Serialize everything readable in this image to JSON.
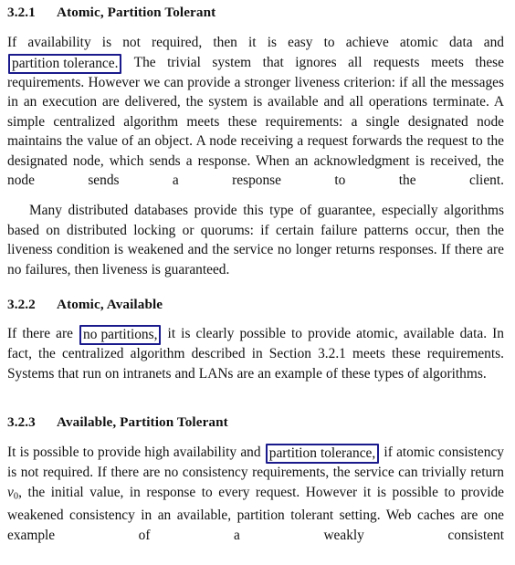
{
  "document": {
    "type": "scanned-paper-excerpt",
    "background_color": "#ffffff",
    "text_color": "#111111",
    "annotation_box_color": "#1a1a8c"
  },
  "sections": [
    {
      "number": "3.2.1",
      "title": "Atomic, Partition Tolerant",
      "paragraphs": [
        {
          "id": "p1",
          "indent": false,
          "runs": [
            {
              "type": "text",
              "text": "If availability is not required, then it is easy to achieve atomic data and "
            },
            {
              "type": "boxed",
              "text": "partition tolerance."
            },
            {
              "type": "text",
              "text": " The trivial system that ignores all requests meets these requirements. However we can provide a stronger liveness criterion: if all the messages in an execution are delivered, the system is available and all operations terminate. A simple centralized algorithm meets these requirements: a single designated node maintains the value of an object. A node receiving a request forwards the request to the designated node, which sends a response. When an acknowledgment is received, the node sends a response to the client."
            }
          ]
        },
        {
          "id": "p2",
          "indent": true,
          "runs": [
            {
              "type": "text",
              "text": "Many distributed databases provide this type of guarantee, especially algorithms based on distributed locking or quorums: if certain failure patterns occur, then the liveness condition is weakened and the service no longer returns responses. If there are no failures, then liveness is guaranteed."
            }
          ]
        }
      ]
    },
    {
      "number": "3.2.2",
      "title": "Atomic, Available",
      "paragraphs": [
        {
          "id": "p3",
          "indent": false,
          "runs": [
            {
              "type": "text",
              "text": "If there are "
            },
            {
              "type": "boxed",
              "text": "no partitions,"
            },
            {
              "type": "text",
              "text": " it is clearly possible to provide atomic, available data. In fact, the centralized algorithm described in Section 3.2.1 meets these requirements. Systems that run on intranets and LANs are an example of these types of algorithms."
            }
          ]
        }
      ]
    },
    {
      "number": "3.2.3",
      "title": "Available, Partition Tolerant",
      "paragraphs": [
        {
          "id": "p4",
          "indent": false,
          "runs": [
            {
              "type": "text",
              "text": "It is possible to provide high availability and "
            },
            {
              "type": "boxed",
              "text": "partition tolerance,"
            },
            {
              "type": "text",
              "text": " if atomic consistency is not required. If there are no consistency requirements, the service can trivially return "
            },
            {
              "type": "math",
              "text": "v",
              "subscript": "0"
            },
            {
              "type": "text",
              "text": ", the initial value, in response to every request. However it is possible to provide weakened consistency in an available, partition tolerant setting. Web caches are one example of a weakly consistent"
            }
          ]
        }
      ]
    }
  ],
  "headings": {
    "s1_num": "3.2.1",
    "s1_title": "Atomic, Partition Tolerant",
    "s2_num": "3.2.2",
    "s2_title": "Atomic, Available",
    "s3_num": "3.2.3",
    "s3_title": "Available, Partition Tolerant"
  },
  "annotations": [
    {
      "id": "a1",
      "phrase": "partition tolerance.",
      "section": "3.2.1"
    },
    {
      "id": "a2",
      "phrase": "no partitions,",
      "section": "3.2.2"
    },
    {
      "id": "a3",
      "phrase": "partition tolerance,",
      "section": "3.2.3"
    }
  ]
}
